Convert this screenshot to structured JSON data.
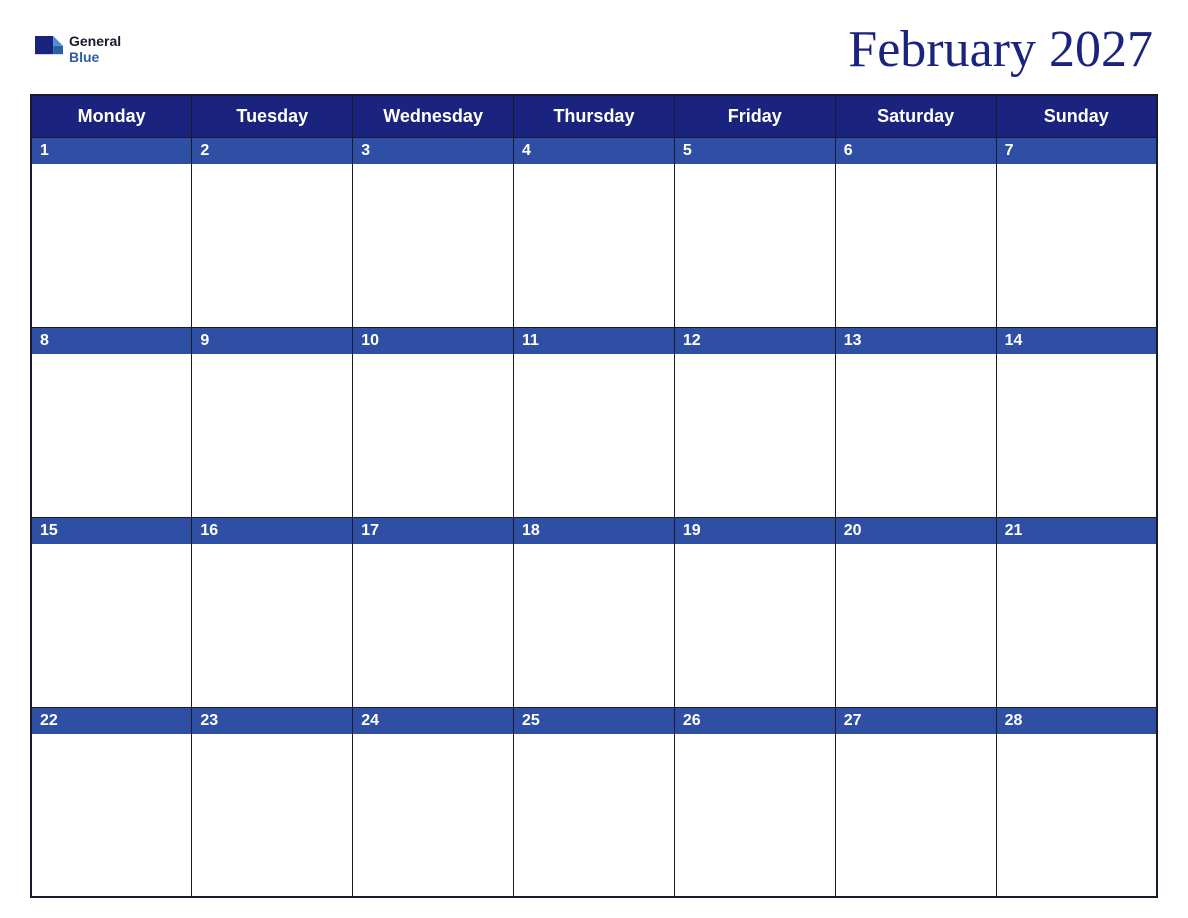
{
  "header": {
    "logo": {
      "general": "General",
      "blue": "Blue"
    },
    "title": "February 2027"
  },
  "calendar": {
    "days_of_week": [
      "Monday",
      "Tuesday",
      "Wednesday",
      "Thursday",
      "Friday",
      "Saturday",
      "Sunday"
    ],
    "weeks": [
      [
        {
          "date": "1",
          "empty": false
        },
        {
          "date": "2",
          "empty": false
        },
        {
          "date": "3",
          "empty": false
        },
        {
          "date": "4",
          "empty": false
        },
        {
          "date": "5",
          "empty": false
        },
        {
          "date": "6",
          "empty": false
        },
        {
          "date": "7",
          "empty": false
        }
      ],
      [
        {
          "date": "8",
          "empty": false
        },
        {
          "date": "9",
          "empty": false
        },
        {
          "date": "10",
          "empty": false
        },
        {
          "date": "11",
          "empty": false
        },
        {
          "date": "12",
          "empty": false
        },
        {
          "date": "13",
          "empty": false
        },
        {
          "date": "14",
          "empty": false
        }
      ],
      [
        {
          "date": "15",
          "empty": false
        },
        {
          "date": "16",
          "empty": false
        },
        {
          "date": "17",
          "empty": false
        },
        {
          "date": "18",
          "empty": false
        },
        {
          "date": "19",
          "empty": false
        },
        {
          "date": "20",
          "empty": false
        },
        {
          "date": "21",
          "empty": false
        }
      ],
      [
        {
          "date": "22",
          "empty": false
        },
        {
          "date": "23",
          "empty": false
        },
        {
          "date": "24",
          "empty": false
        },
        {
          "date": "25",
          "empty": false
        },
        {
          "date": "26",
          "empty": false
        },
        {
          "date": "27",
          "empty": false
        },
        {
          "date": "28",
          "empty": false
        }
      ]
    ],
    "colors": {
      "header_bg": "#1a237e",
      "day_header_bg": "#2e4fa3",
      "day_header_text": "#ffffff",
      "border": "#1a1a2e"
    }
  }
}
